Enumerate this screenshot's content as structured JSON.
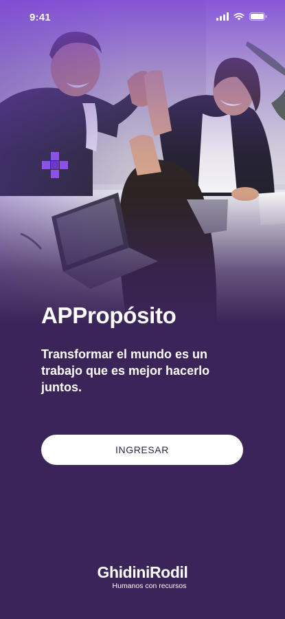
{
  "status_bar": {
    "time": "9:41",
    "icons": [
      "cellular-signal-icon",
      "wifi-icon",
      "battery-icon"
    ]
  },
  "hero": {
    "image": "team-high-five-photo",
    "brand_mark": "purple-pixel-cross-icon"
  },
  "content": {
    "title": "APPropósito",
    "tagline": "Transformar el mundo es un trabajo que es mejor hacerlo juntos.",
    "button_label": "INGRESAR"
  },
  "footer": {
    "logo_name": "GhidiniRodil",
    "logo_tagline": "Humanos con recursos"
  },
  "colors": {
    "background": "#3a2458",
    "accent": "#7a40d6",
    "button_bg": "#ffffff",
    "button_text": "#2e1f45",
    "brand_mark": "#8a52e6"
  }
}
